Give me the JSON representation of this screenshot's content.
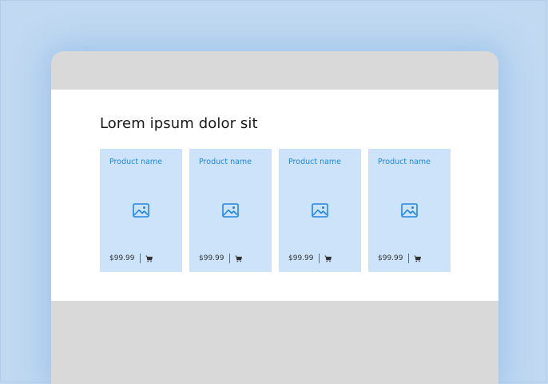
{
  "page": {
    "heading": "Lorem ipsum dolor sit"
  },
  "products": [
    {
      "name": "Product name",
      "price": "$99.99"
    },
    {
      "name": "Product name",
      "price": "$99.99"
    },
    {
      "name": "Product name",
      "price": "$99.99"
    },
    {
      "name": "Product name",
      "price": "$99.99"
    }
  ],
  "icons": {
    "image": "image-placeholder-icon",
    "cart": "cart-icon"
  },
  "colors": {
    "background": "#c1d9f1",
    "browser_chrome": "#d9d9d9",
    "card_background": "#cce3f9",
    "accent": "#1e88e5",
    "text": "#1a1a1a"
  }
}
